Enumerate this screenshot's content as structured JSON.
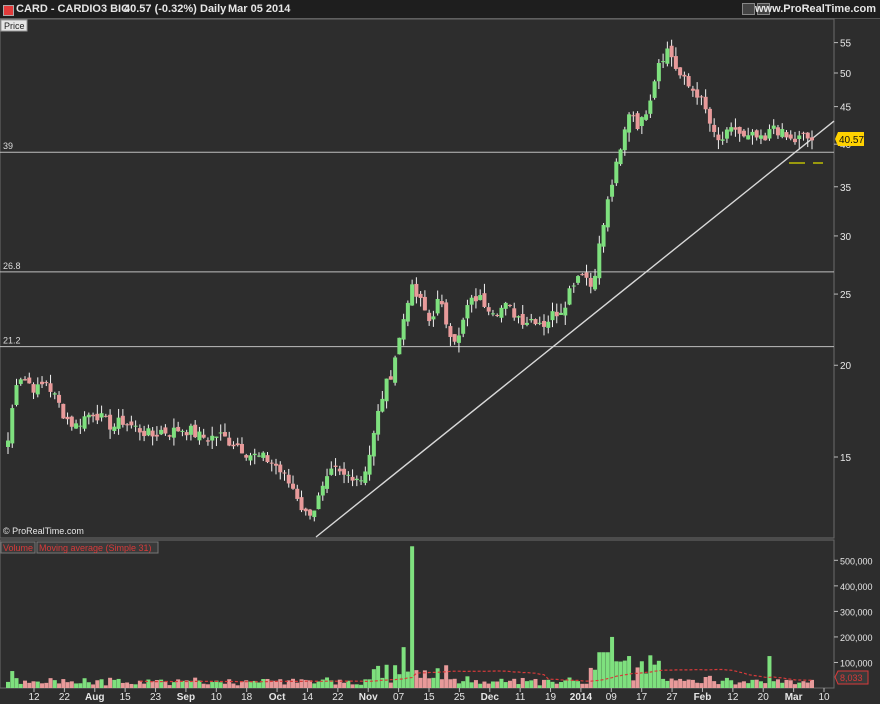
{
  "title_bar": {
    "symbol": "CARD - CARDIO3 BIO",
    "quote": "40.57 (-0.32%)",
    "period": "Daily",
    "date": "Mar 05 2014",
    "site": "www.ProRealTime.com"
  },
  "price_panel": {
    "label": "Price",
    "copyright": "© ProRealTime.com",
    "last_price_label": "40.57",
    "hlines": [
      {
        "label": "39",
        "value": 39
      },
      {
        "label": "26.8",
        "value": 26.8
      },
      {
        "label": "21.2",
        "value": 21.2
      }
    ]
  },
  "volume_panel": {
    "label_volume": "Volume",
    "label_ma": "Moving average (Simple 31)",
    "last_value_label": "8,033"
  },
  "colors": {
    "background": "#2d2d2d",
    "up_candle": "#7ee07e",
    "down_candle": "#e89a9a",
    "wick": "#f2f2f2",
    "ma_line": "#d83a3a",
    "hline": "#bfbfbf",
    "last_price_box": "#ffd200"
  },
  "chart_data": [
    {
      "type": "candlestick",
      "scale": "log",
      "yticks": [
        15,
        20,
        25,
        30,
        35,
        40,
        45,
        50,
        55
      ],
      "ylim": [
        12,
        58
      ],
      "xtick_labels": [
        "12",
        "22",
        "Aug",
        "15",
        "23",
        "Sep",
        "10",
        "18",
        "Oct",
        "14",
        "22",
        "Nov",
        "07",
        "15",
        "25",
        "Dec",
        "11",
        "19",
        "2014",
        "09",
        "17",
        "27",
        "Feb",
        "12",
        "20",
        "Mar",
        "10"
      ],
      "close_path": [
        15.8,
        19.5,
        19.0,
        18.5,
        19.0,
        18.0,
        17.0,
        16.5,
        17.0,
        17.3,
        16.8,
        16.5,
        16.8,
        16.5,
        16.3,
        16.0,
        16.3,
        16.2,
        16.4,
        16.3,
        16.0,
        15.9,
        16.1,
        15.8,
        15.6,
        15.2,
        15.0,
        14.9,
        14.6,
        14.0,
        13.5,
        12.5,
        12.8,
        13.6,
        14.4,
        14.1,
        14.2,
        14.0,
        15.5,
        18.0,
        19.5,
        22.0,
        25.5,
        24.5,
        23.0,
        24.5,
        22.5,
        21.5,
        24.0,
        24.8,
        24.2,
        23.8,
        24.0,
        23.5,
        23.0,
        23.2,
        22.8,
        23.5,
        24.0,
        26.0,
        27.0,
        25.5,
        30.0,
        35.0,
        39.0,
        45.0,
        42.0,
        46.0,
        52.0,
        54.0,
        50.0,
        48.0,
        47.0,
        44.0,
        40.0,
        41.0,
        42.0,
        40.5,
        41.0,
        40.0,
        42.5,
        41.0,
        40.3,
        40.9,
        40.57
      ],
      "hlines": [
        39,
        26.8,
        21.2
      ],
      "trendline": {
        "from_value": 12.0,
        "to_value": 43.0,
        "label": ""
      }
    },
    {
      "type": "bar",
      "series_name": "Volume",
      "yticks": [
        "100,000",
        "200,000",
        "300,000",
        "400,000",
        "500,000"
      ],
      "ytick_values": [
        100000,
        200000,
        300000,
        400000,
        500000
      ],
      "ylim": [
        0,
        560000
      ],
      "peaks": [
        {
          "date": "Nov 05",
          "value": 555000
        },
        {
          "date": "Nov 04",
          "value": 160000
        },
        {
          "date": "Jan 08",
          "value": 200000
        },
        {
          "date": "Feb 24",
          "value": 125000
        }
      ],
      "moving_average": {
        "type": "simple",
        "period": 31
      }
    }
  ]
}
